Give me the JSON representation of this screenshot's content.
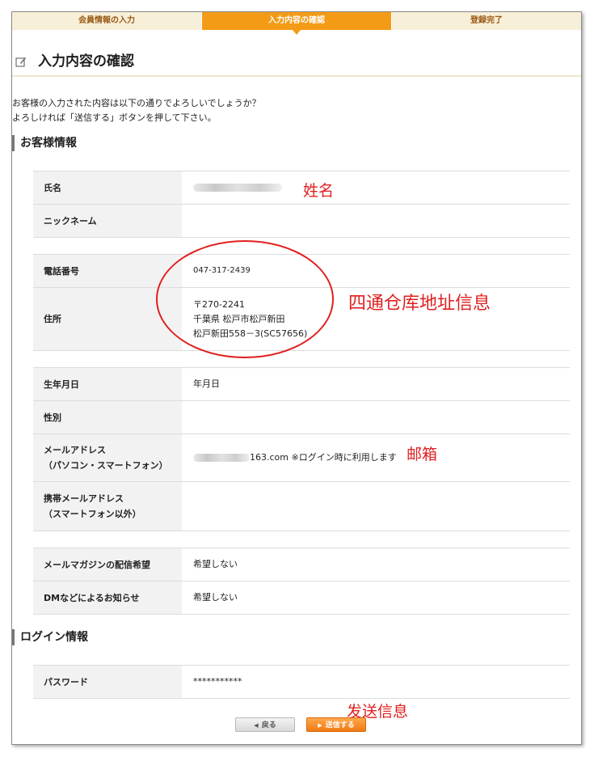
{
  "steps": [
    {
      "label": "会員情報の入力"
    },
    {
      "label": "入力内容の確認"
    },
    {
      "label": "登録完了"
    }
  ],
  "page_title": "入力内容の確認",
  "intro": {
    "line1": "お客様の入力された内容は以下の通りでよろしいでしょうか？",
    "line2": "よろしければ「送信する」ボタンを押して下さい。"
  },
  "customer_section": {
    "title": "お客様情報",
    "name_label": "氏名",
    "nickname_label": "ニックネーム",
    "phone_label": "電話番号",
    "phone_value": "047-317-2439",
    "address_label": "住所",
    "address_line1": "〒270-2241",
    "address_line2": "千葉県 松戸市松戸新田",
    "address_line3": "松戸新田558－3(SC57656)",
    "birthday_label": "生年月日",
    "birthday_value": "年月日",
    "gender_label": "性別",
    "email_label_line1": "メールアドレス",
    "email_label_line2": "（パソコン・スマートフォン）",
    "email_value": "163.com ※ログイン時に利用します",
    "mobile_label_line1": "携帯メールアドレス",
    "mobile_label_line2": "（スマートフォン以外）",
    "magazine_label": "メールマガジンの配信希望",
    "magazine_value": "希望しない",
    "dm_label": "DMなどによるお知らせ",
    "dm_value": "希望しない"
  },
  "login_section": {
    "title": "ログイン情報",
    "password_label": "パスワード",
    "password_value": "***********"
  },
  "buttons": {
    "back_label": "戻る",
    "send_label": "送信する"
  },
  "annotations": {
    "name": "姓名",
    "address": "四通仓库地址信息",
    "email": "邮箱",
    "send": "发送信息",
    "color": "#e02020"
  }
}
